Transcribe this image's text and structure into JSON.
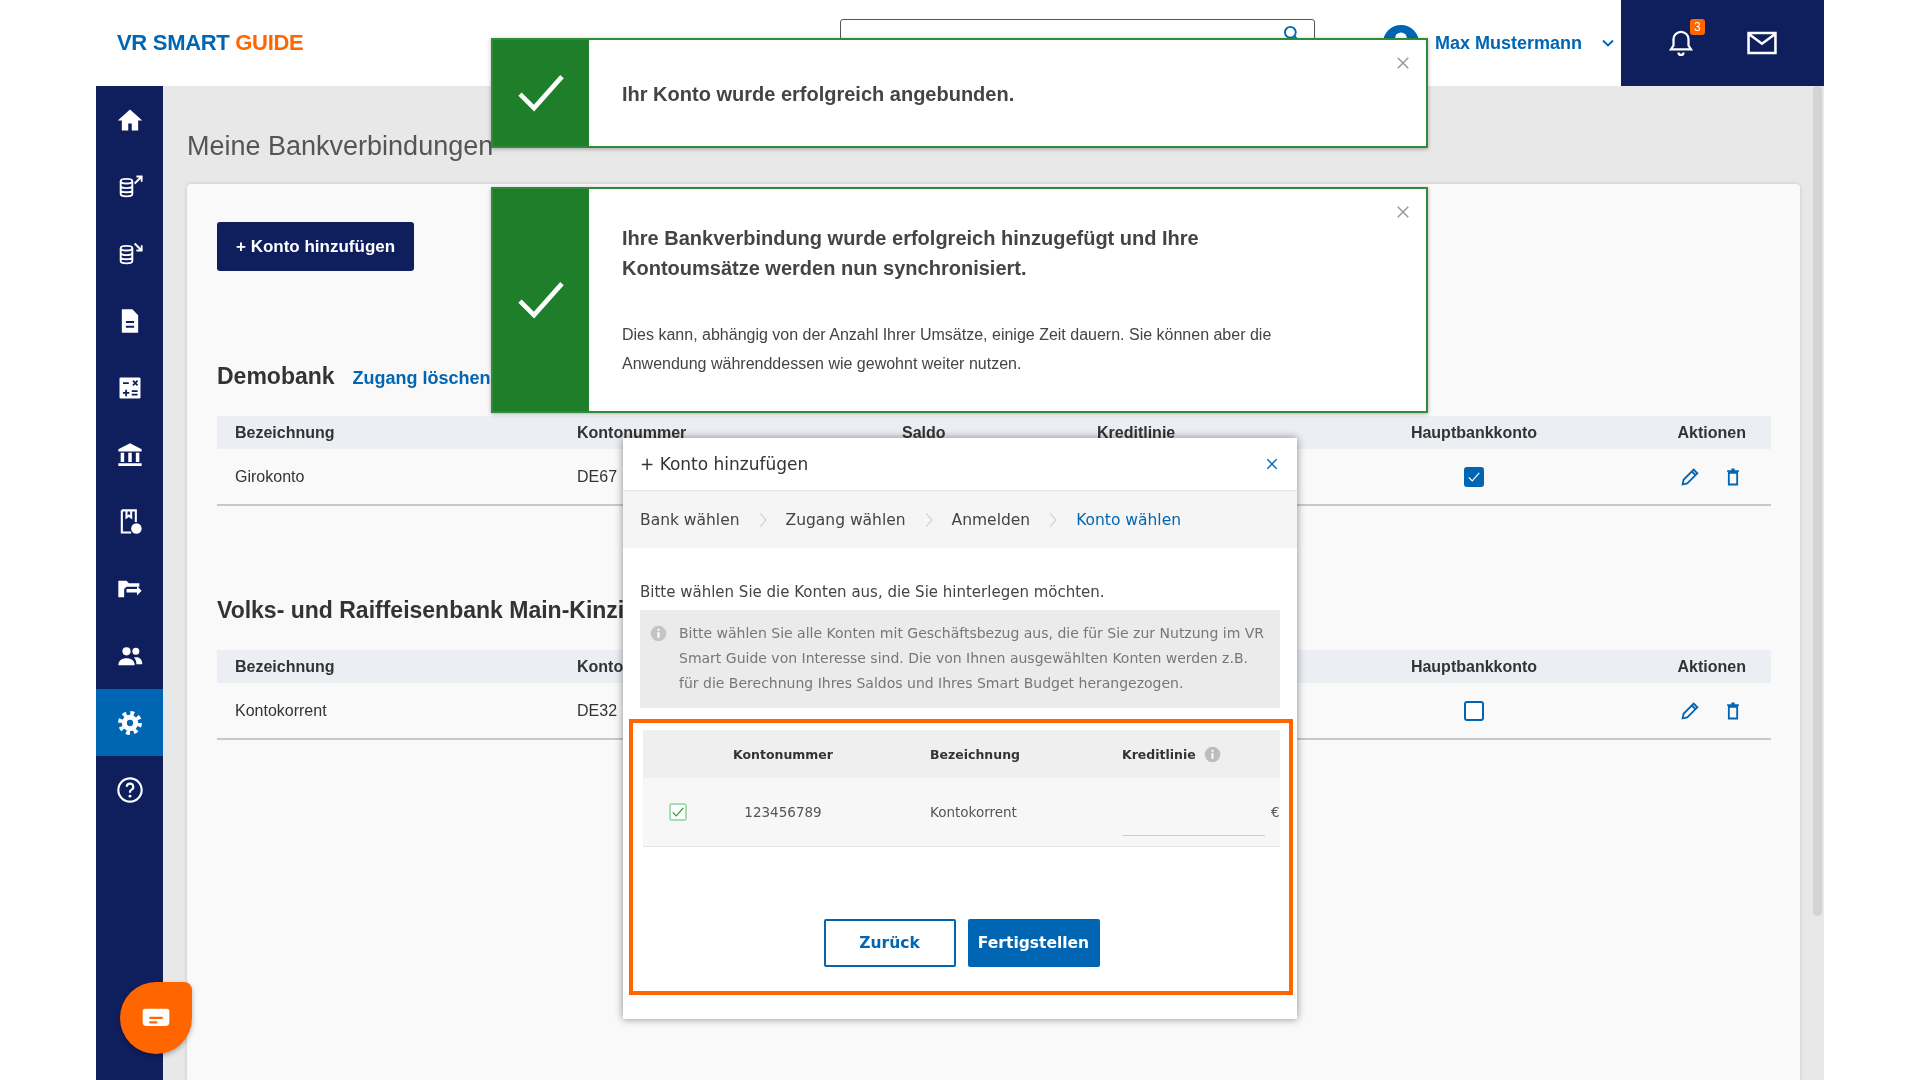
{
  "header": {
    "logo_prefix": "VR SMART",
    "logo_suffix": "GUIDE",
    "user_name": "Max Mustermann",
    "notification_count": "3"
  },
  "sidebar": {
    "items": [
      {
        "kind": "home",
        "selected": false
      },
      {
        "kind": "coins-out",
        "selected": false
      },
      {
        "kind": "coins-in",
        "selected": false
      },
      {
        "kind": "document",
        "selected": false
      },
      {
        "kind": "calculator",
        "selected": false
      },
      {
        "kind": "bank",
        "selected": false
      },
      {
        "kind": "document-euro",
        "selected": false
      },
      {
        "kind": "folder-arrow",
        "selected": false
      },
      {
        "kind": "people",
        "selected": false
      },
      {
        "kind": "gear",
        "selected": true
      },
      {
        "kind": "help",
        "selected": false
      }
    ]
  },
  "page": {
    "title": "Meine Bankverbindungen",
    "add_button": "+ Konto hinzufügen"
  },
  "banks": [
    {
      "name": "Demobank",
      "delete_link": "Zugang löschen",
      "columns": {
        "name": "Bezeichnung",
        "number": "Kontonummer",
        "balance": "Saldo",
        "credit_line": "Kreditlinie",
        "main_account": "Hauptbankkonto",
        "actions": "Aktionen"
      },
      "rows": [
        {
          "name": "Girokonto",
          "number": "DE67",
          "main_account": true
        }
      ]
    },
    {
      "name": "Volks- und Raiffeisenbank Main-Kinzi",
      "columns": {
        "name": "Bezeichnung",
        "number": "Konto",
        "main_account": "Hauptbankkonto",
        "actions": "Aktionen"
      },
      "rows": [
        {
          "name": "Kontokorrent",
          "number": "DE32",
          "main_account": false
        }
      ]
    }
  ],
  "toasts": [
    {
      "title": "Ihr Konto wurde erfolgreich angebunden."
    },
    {
      "title": "Ihre Bankverbindung wurde erfolgreich hinzugefügt und Ihre Kontoumsätze werden nun synchronisiert.",
      "body": "Dies kann, abhängig von der Anzahl Ihrer Umsätze, einige Zeit dauern. Sie können aber die Anwendung währenddessen wie gewohnt weiter nutzen."
    }
  ],
  "modal": {
    "title": "+ Konto hinzufügen",
    "steps": [
      {
        "label": "Bank wählen",
        "selected": false
      },
      {
        "label": "Zugang wählen",
        "selected": false
      },
      {
        "label": "Anmelden",
        "selected": false
      },
      {
        "label": "Konto wählen",
        "selected": true
      }
    ],
    "intro": "Bitte wählen Sie die Konten aus, die Sie hinterlegen möchten.",
    "info": "Bitte wählen Sie alle Konten mit Geschäftsbezug aus, die für Sie zur Nutzung im VR Smart Guide von Interesse sind. Die von Ihnen ausgewählten Konten werden z.B. für die Berechnung Ihres Saldos und Ihres Smart Budget herangezogen.",
    "columns": {
      "number": "Kontonummer",
      "name": "Bezeichnung",
      "credit_line": "Kreditlinie"
    },
    "rows": [
      {
        "checked": true,
        "number": "123456789",
        "name": "Kontokorrent",
        "currency": "€"
      }
    ],
    "buttons": [
      {
        "label": "Zurück",
        "kind": "secondary"
      },
      {
        "label": "Fertigstellen",
        "kind": "primary"
      }
    ]
  }
}
